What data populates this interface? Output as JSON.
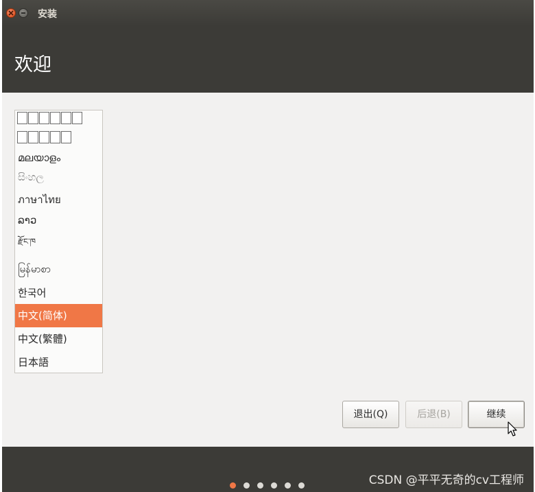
{
  "window": {
    "title": "安装"
  },
  "header": {
    "title": "欢迎"
  },
  "language_list": {
    "items": [
      {
        "label": "മലയാളം",
        "selected": false
      },
      {
        "label": "සිංහල",
        "selected": false
      },
      {
        "label": "ภาษาไทย",
        "selected": false
      },
      {
        "label": "ລາວ",
        "selected": false
      },
      {
        "label": "རྫོང་ཁ",
        "selected": false
      },
      {
        "label": "မြန်မာစာ",
        "selected": false
      },
      {
        "label": "한국어",
        "selected": false
      },
      {
        "label": "中文(简体)",
        "selected": true
      },
      {
        "label": "中文(繁體)",
        "selected": false
      },
      {
        "label": "日本語",
        "selected": false
      }
    ]
  },
  "buttons": {
    "quit": "退出(Q)",
    "back": "后退(B)",
    "continue": "继续"
  },
  "progress": {
    "total_steps": 6,
    "current_step": 1
  },
  "watermark": "CSDN @平平无奇的cv工程师",
  "colors": {
    "accent": "#f07746",
    "header_bg": "#3c3b37",
    "window_bg": "#f2f1f0"
  }
}
